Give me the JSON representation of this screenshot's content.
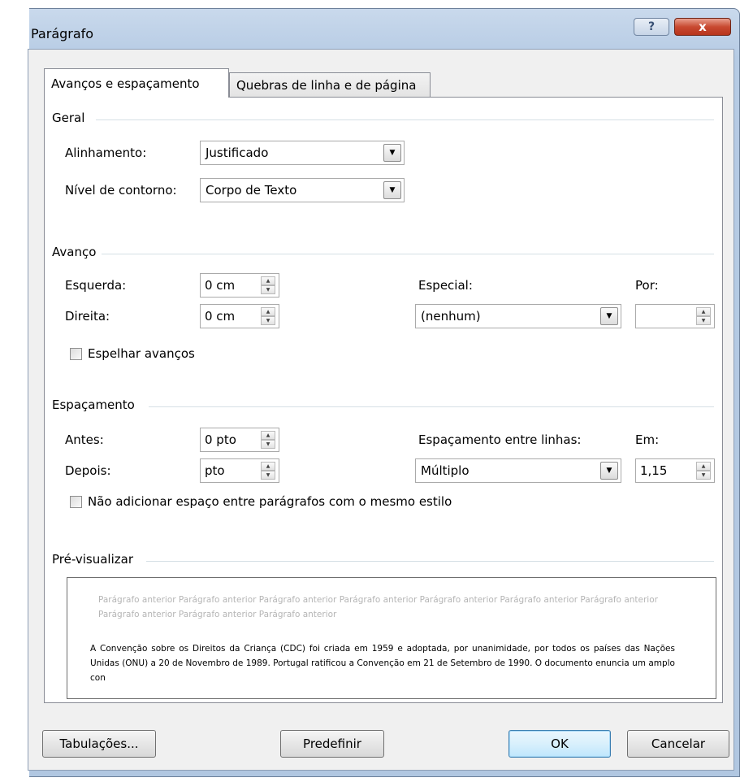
{
  "window": {
    "title": "Parágrafo",
    "help_label": "?",
    "close_label": "x"
  },
  "tabs": [
    {
      "label": "Avanços e espaçamento",
      "active": true
    },
    {
      "label": "Quebras de linha e de página",
      "active": false
    }
  ],
  "geral": {
    "heading": "Geral",
    "alignment_label": "Alinhamento:",
    "alignment_value": "Justificado",
    "outline_label": "Nível de contorno:",
    "outline_value": "Corpo de Texto"
  },
  "avanco": {
    "heading": "Avanço",
    "left_label": "Esquerda:",
    "left_value": "0 cm",
    "right_label": "Direita:",
    "right_value": "0 cm",
    "special_label": "Especial:",
    "special_value": "(nenhum)",
    "by_label": "Por:",
    "by_value": "",
    "mirror_label": "Espelhar avanços"
  },
  "espacamento": {
    "heading": "Espaçamento",
    "before_label": "Antes:",
    "before_value": "0 pto",
    "after_label": "Depois:",
    "after_value": "pto",
    "line_spacing_label": "Espaçamento entre linhas:",
    "line_spacing_value": "Múltiplo",
    "at_label": "Em:",
    "at_value": "1,15",
    "no_space_label": "Não adicionar espaço entre parágrafos com o mesmo estilo"
  },
  "preview": {
    "heading": "Pré-visualizar",
    "previous_text": "Parágrafo anterior Parágrafo anterior Parágrafo anterior Parágrafo anterior Parágrafo anterior Parágrafo anterior Parágrafo anterior Parágrafo anterior Parágrafo anterior Parágrafo anterior",
    "main_text": "A Convenção sobre os Direitos da Criança (CDC) foi criada em 1959 e adoptada, por unanimidade, por todos os países das Nações Unidas (ONU) a 20 de Novembro de 1989. Portugal ratificou a Convenção em 21 de Setembro de 1990. O documento enuncia um amplo con"
  },
  "buttons": {
    "tabs": "Tabulações...",
    "default": "Predefinir",
    "ok": "OK",
    "cancel": "Cancelar"
  },
  "colors": {
    "title_bar": "#b6cbe4",
    "close_button": "#c84a31",
    "panel": "#ffffff"
  }
}
